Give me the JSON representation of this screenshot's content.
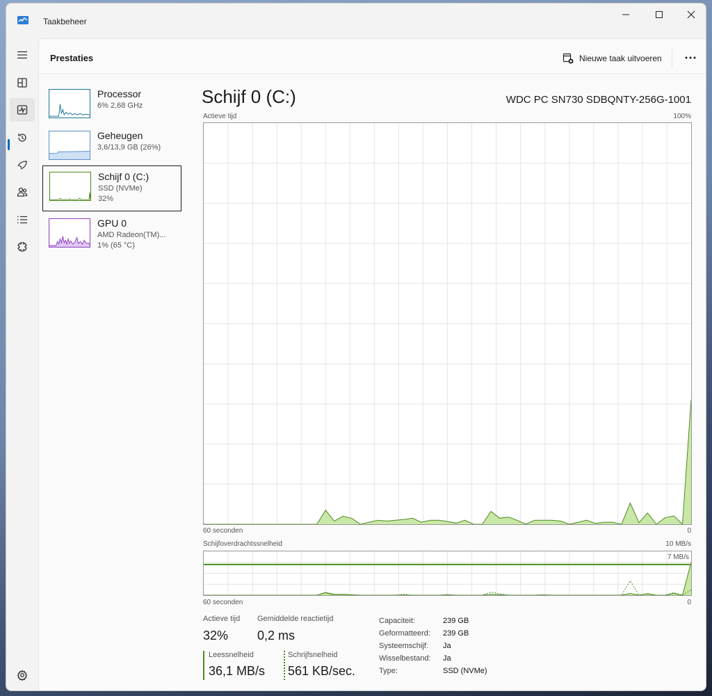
{
  "window": {
    "title": "Taakbeheer"
  },
  "header": {
    "page_title": "Prestaties",
    "new_task_label": "Nieuwe taak uitvoeren"
  },
  "rail": {
    "items": [
      "menu-icon",
      "processes-icon",
      "performance-icon",
      "app-history-icon",
      "startup-icon",
      "users-icon",
      "details-icon",
      "services-icon",
      "settings-icon"
    ]
  },
  "devices": [
    {
      "name": "Processor",
      "line1": "6% 2,68 GHz",
      "line2": "",
      "color": "#1a7391"
    },
    {
      "name": "Geheugen",
      "line1": "3,6/13,9 GB (26%)",
      "line2": "",
      "color": "#5a8fc7"
    },
    {
      "name": "Schijf 0 (C:)",
      "line1": "SSD (NVMe)",
      "line2": "32%",
      "color": "#4d8a1e"
    },
    {
      "name": "GPU 0",
      "line1": "AMD Radeon(TM)...",
      "line2": "1% (65 °C)",
      "color": "#8a3fbf"
    }
  ],
  "detail": {
    "title": "Schijf 0 (C:)",
    "model": "WDC PC SN730 SDBQNTY-256G-1001"
  },
  "chart_data": [
    {
      "type": "area",
      "title": "Actieve tijd",
      "ymax_label": "100%",
      "x_left_label": "60 seconden",
      "x_right_label": "0",
      "ylim": [
        0,
        100
      ],
      "series": [
        {
          "values": [
            0,
            0,
            0,
            0,
            0,
            0,
            0,
            0,
            0,
            0,
            0,
            0,
            0,
            0,
            3.5,
            0.8,
            2,
            1.5,
            0,
            0.5,
            1,
            0.8,
            1,
            1.2,
            1.5,
            0.5,
            1,
            1,
            0.7,
            0.3,
            1,
            0,
            0,
            3.2,
            1.5,
            1.8,
            1,
            0,
            1,
            1,
            1,
            0.8,
            0,
            0.5,
            1,
            0.2,
            0.5,
            0.5,
            0,
            5.3,
            0.4,
            2.8,
            0,
            1.6,
            2.1,
            0,
            31
          ]
        }
      ]
    },
    {
      "type": "line",
      "title": "Schijfoverdrachtssnelheid",
      "ymax_label": "10 MB/s",
      "ref_label": "7 MB/s",
      "ref_value": 7,
      "x_left_label": "60 seconden",
      "x_right_label": "0",
      "ylim": [
        0,
        10
      ],
      "series": [
        {
          "values": [
            0,
            0,
            0,
            0,
            0,
            0,
            0,
            0,
            0,
            0,
            0,
            0,
            0,
            0,
            0.6,
            0.2,
            0.2,
            0.1,
            0,
            0,
            0,
            0,
            0,
            0.05,
            0,
            0,
            0,
            0,
            0.1,
            0,
            0,
            0,
            0,
            0.2,
            0.1,
            0,
            0,
            0,
            0,
            0.05,
            0,
            0,
            0,
            0,
            0,
            0,
            0,
            0,
            0,
            0.4,
            0,
            0.3,
            0,
            0,
            0.4,
            0,
            7.5
          ]
        },
        {
          "values": [
            0,
            0,
            0,
            0,
            0,
            0,
            0,
            0,
            0,
            0,
            0,
            0,
            0,
            0,
            0.5,
            0,
            0,
            0,
            0,
            0,
            0,
            0,
            0,
            0.2,
            0,
            0,
            0,
            0,
            0,
            0,
            0,
            0,
            0,
            0.7,
            0.3,
            0,
            0,
            0,
            0,
            0.1,
            0,
            0,
            0,
            0,
            0,
            0,
            0,
            0,
            0,
            3.3,
            0,
            0.4,
            0,
            0,
            0.6,
            0,
            1.2
          ]
        }
      ]
    }
  ],
  "stats": {
    "active_time_label": "Actieve tijd",
    "active_time": "32%",
    "response_label": "Gemiddelde reactietijd",
    "response": "0,2 ms",
    "read_label": "Leessnelheid",
    "read": "36,1 MB/s",
    "write_label": "Schrijfsnelheid",
    "write": "561 KB/sec."
  },
  "props": [
    {
      "key": "Capaciteit:",
      "value": "239 GB"
    },
    {
      "key": "Geformatteerd:",
      "value": "239 GB"
    },
    {
      "key": "Systeemschijf:",
      "value": "Ja"
    },
    {
      "key": "Wisselbestand:",
      "value": "Ja"
    },
    {
      "key": "Type:",
      "value": "SSD (NVMe)"
    }
  ],
  "colors": {
    "accent": "#0067c0",
    "disk_line": "#4d8a1e",
    "disk_fill": "#c9e8a8"
  }
}
